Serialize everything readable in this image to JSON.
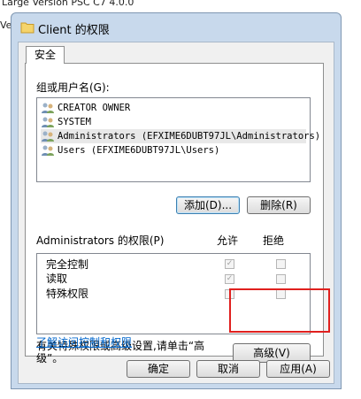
{
  "background": {
    "line1": "Large Version   PSC C7          4.0.0",
    "line2": "Ver"
  },
  "dialog": {
    "title": "Client 的权限",
    "tab_label": "安全",
    "group_label": "组或用户名(G):",
    "users": [
      "CREATOR OWNER",
      "SYSTEM",
      "Administrators (EFXIME6DUBT97JL\\Administrators)",
      "Users (EFXIME6DUBT97JL\\Users)"
    ],
    "add_button": "添加(D)...",
    "remove_button": "删除(R)",
    "perm_header": "Administrators 的权限(P)",
    "allow_header": "允许",
    "deny_header": "拒绝",
    "permissions": [
      {
        "name": "完全控制",
        "allow": true,
        "deny": false
      },
      {
        "name": "读取",
        "allow": true,
        "deny": false
      },
      {
        "name": "特殊权限",
        "allow": false,
        "deny": false
      }
    ],
    "advanced_text": "有关特殊权限或高级设置,请单击“高级”。",
    "advanced_button": "高级(V)",
    "learn_link": "了解访问控制和权限",
    "ok_button": "确定",
    "cancel_button": "取消",
    "apply_button": "应用(A)"
  },
  "colors": {
    "highlight_box": "#e0201e",
    "link": "#0066cc"
  }
}
